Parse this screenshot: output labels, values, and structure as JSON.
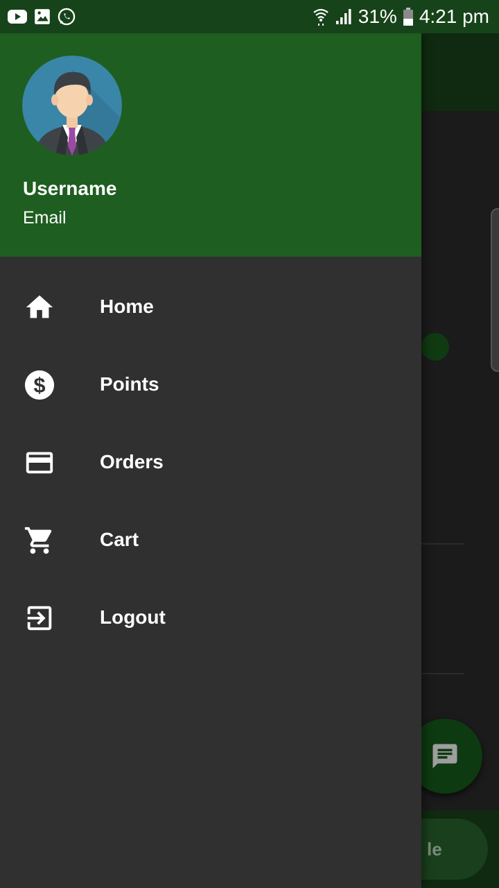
{
  "status_bar": {
    "battery": "31%",
    "time": "4:21 pm",
    "left_icons": [
      "youtube-icon",
      "image-icon",
      "whatsapp-icon"
    ],
    "right_icons": [
      "wifi-icon",
      "signal-icon",
      "battery-icon"
    ]
  },
  "drawer": {
    "header": {
      "username": "Username",
      "email": "Email",
      "avatar": "avatar-person-icon"
    },
    "items": [
      {
        "label": "Home",
        "icon": "home-icon"
      },
      {
        "label": "Points",
        "icon": "dollar-icon"
      },
      {
        "label": "Orders",
        "icon": "credit-card-icon"
      },
      {
        "label": "Cart",
        "icon": "cart-icon"
      },
      {
        "label": "Logout",
        "icon": "logout-icon"
      }
    ]
  },
  "background": {
    "bottom_button_label_fragment": "le",
    "fab_icon": "chat-icon"
  },
  "colors": {
    "header_green": "#1e5e20",
    "status_bar": "#17431a",
    "drawer_bg": "#303030",
    "text": "#ffffff"
  }
}
